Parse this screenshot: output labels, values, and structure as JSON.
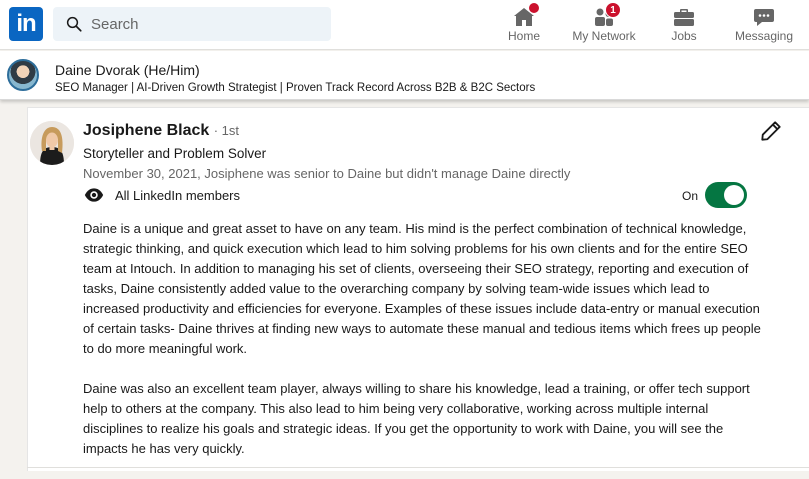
{
  "nav": {
    "logo_text": "in",
    "search_placeholder": "Search",
    "items": [
      {
        "label": "Home",
        "icon": "home-icon",
        "badge": ""
      },
      {
        "label": "My Network",
        "icon": "people-icon",
        "badge": "1"
      },
      {
        "label": "Jobs",
        "icon": "briefcase-icon",
        "badge": ""
      },
      {
        "label": "Messaging",
        "icon": "message-icon",
        "badge": ""
      }
    ]
  },
  "profile": {
    "name": "Daine Dvorak",
    "pronouns": "(He/Him)",
    "headline": "SEO Manager | AI-Driven Growth Strategist | Proven Track Record Across B2B & B2C Sectors"
  },
  "recommendation": {
    "recommender_name": "Josiphene Black",
    "degree": "· 1st",
    "title": "Storyteller and Problem Solver",
    "date_relation": "November 30, 2021, Josiphene was senior to Daine but didn't manage Daine directly",
    "visibility": "All LinkedIn members",
    "toggle_label": "On",
    "toggle_on": true,
    "paragraphs": [
      "Daine is a unique and great asset to have on any team. His mind is the perfect combination of technical knowledge, strategic thinking, and quick execution which lead to him solving problems for his own clients and for the entire SEO team at Intouch. In addition to managing his set of clients, overseeing their SEO strategy, reporting and execution of tasks, Daine consistently added value to the overarching company by solving team-wide issues which lead to increased productivity and efficiencies for everyone. Examples of these issues include data-entry or manual execution of certain tasks- Daine thrives at finding new ways to automate these manual and tedious items which frees up people to do more meaningful work.",
      "Daine was also an excellent team player, always willing to share his knowledge, lead a training, or offer tech support help to others at the company. This also lead to him being very collaborative, working across multiple internal disciplines to realize his goals and strategic ideas. If you get the opportunity to work with Daine, you will see the impacts he has very quickly."
    ]
  },
  "colors": {
    "brand": "#0a66c2",
    "badge": "#cb112d",
    "toggle_on": "#057642"
  }
}
